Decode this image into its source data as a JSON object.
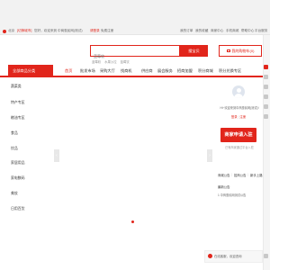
{
  "top_bar": {
    "location": "北京",
    "switch_label": "[切换城市]",
    "greeting": "您好，欢迎来到",
    "site_name": "中商惠民网(测试)",
    "login": "请登录",
    "register": "免费注册",
    "links": [
      "我的订单",
      "我的收藏",
      "商家中心",
      "手机商城",
      "帮助中心",
      "平台服务"
    ]
  },
  "header": {
    "search_placeholder": "蓝莓软",
    "search_button": "搜宝贝",
    "hot_words": [
      "蓝莓软",
      "水果沙拉",
      "蓝莓饮"
    ],
    "cart_label": "我的购物车(0)"
  },
  "nav": {
    "all_categories": "全部商品分类",
    "items": [
      {
        "label": "首页",
        "active": true
      },
      {
        "label": "批发市场",
        "active": false
      },
      {
        "label": "采购大厅",
        "active": false
      },
      {
        "label": "找商机",
        "active": false
      },
      {
        "label": "供应商",
        "active": false
      },
      {
        "label": "展会服务",
        "active": false
      },
      {
        "label": "招商加盟",
        "active": false
      },
      {
        "label": "积分商城",
        "active": false
      },
      {
        "label": "积分兑换专区",
        "active": false
      }
    ]
  },
  "categories": [
    "蔬菜类",
    "特产专区",
    "粮油专区",
    "食品",
    "饮品",
    "家居用品",
    "家电数码",
    "美妆",
    "日用百货"
  ],
  "right_panel": {
    "welcome": "Hi~欢迎来到中商惠民网(测试)!",
    "login": "登录",
    "register": "注册",
    "apply_button": "商家申请入驻",
    "apply_note": "已有商家通过平台入驻",
    "tabs": [
      "商城公告",
      "招商公告",
      "新手上路"
    ],
    "notice_title": "最新公告",
    "notice_item": "1 中商惠民网测试公告"
  },
  "float_bar": {
    "text": "在线客服，欢迎咨询"
  },
  "colors": {
    "accent": "#e1251b",
    "top_bar_bg": "#f2f2f2"
  }
}
